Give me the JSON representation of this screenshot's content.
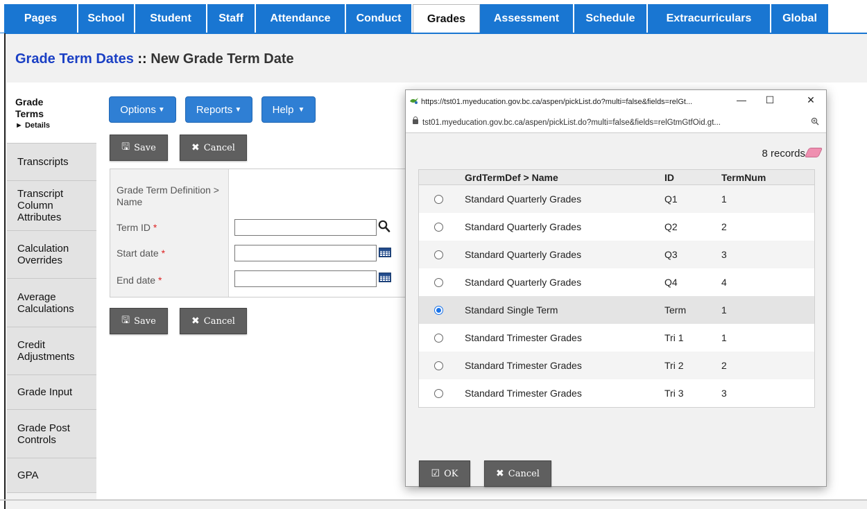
{
  "nav": {
    "tabs": [
      {
        "label": "Pages"
      },
      {
        "label": "School"
      },
      {
        "label": "Student"
      },
      {
        "label": "Staff"
      },
      {
        "label": "Attendance"
      },
      {
        "label": "Conduct"
      },
      {
        "label": "Grades",
        "active": true
      },
      {
        "label": "Assessment"
      },
      {
        "label": "Schedule"
      },
      {
        "label": "Extracurriculars"
      },
      {
        "label": "Global"
      }
    ]
  },
  "title": {
    "link": "Grade Term Dates",
    "separator": " :: ",
    "current": "New Grade Term Date"
  },
  "sidebar": {
    "items": [
      {
        "label": "Grade Terms",
        "sub": "► Details",
        "active": true
      },
      {
        "label": "Transcripts"
      },
      {
        "label": "Transcript Column Attributes"
      },
      {
        "label": "Calculation Overrides"
      },
      {
        "label": "Average Calculations"
      },
      {
        "label": "Credit Adjustments"
      },
      {
        "label": "Grade Input"
      },
      {
        "label": "Grade Post Controls"
      },
      {
        "label": "GPA"
      }
    ]
  },
  "toolbar": {
    "options_label": "Options",
    "reports_label": "Reports",
    "help_label": "Help",
    "save_label": "Save",
    "cancel_label": "Cancel"
  },
  "form": {
    "definition_label": "Grade Term Definition > Name",
    "term_id_label": "Term ID",
    "start_date_label": "Start date",
    "end_date_label": "End date",
    "required_mark": "*",
    "term_id_value": "",
    "start_date_value": "",
    "end_date_value": ""
  },
  "popup": {
    "window_title": "https://tst01.myeducation.gov.bc.ca/aspen/pickList.do?multi=false&fields=relGt...",
    "address": "tst01.myeducation.gov.bc.ca/aspen/pickList.do?multi=false&fields=relGtmGtfOid.gt...",
    "records_label": "8 records",
    "columns": [
      "GrdTermDef > Name",
      "ID",
      "TermNum"
    ],
    "rows": [
      {
        "name": "Standard Quarterly Grades",
        "id": "Q1",
        "term": "1",
        "selected": false
      },
      {
        "name": "Standard Quarterly Grades",
        "id": "Q2",
        "term": "2",
        "selected": false
      },
      {
        "name": "Standard Quarterly Grades",
        "id": "Q3",
        "term": "3",
        "selected": false
      },
      {
        "name": "Standard Quarterly Grades",
        "id": "Q4",
        "term": "4",
        "selected": false
      },
      {
        "name": "Standard Single Term",
        "id": "Term",
        "term": "1",
        "selected": true
      },
      {
        "name": "Standard Trimester Grades",
        "id": "Tri 1",
        "term": "1",
        "selected": false
      },
      {
        "name": "Standard Trimester Grades",
        "id": "Tri 2",
        "term": "2",
        "selected": false
      },
      {
        "name": "Standard Trimester Grades",
        "id": "Tri 3",
        "term": "3",
        "selected": false
      }
    ],
    "ok_label": "OK",
    "cancel_label": "Cancel"
  },
  "colors": {
    "tab_blue": "#1976d2",
    "button_blue": "#2f7fd4",
    "title_link": "#1a3fc4",
    "button_grey": "#5f5f5f"
  }
}
